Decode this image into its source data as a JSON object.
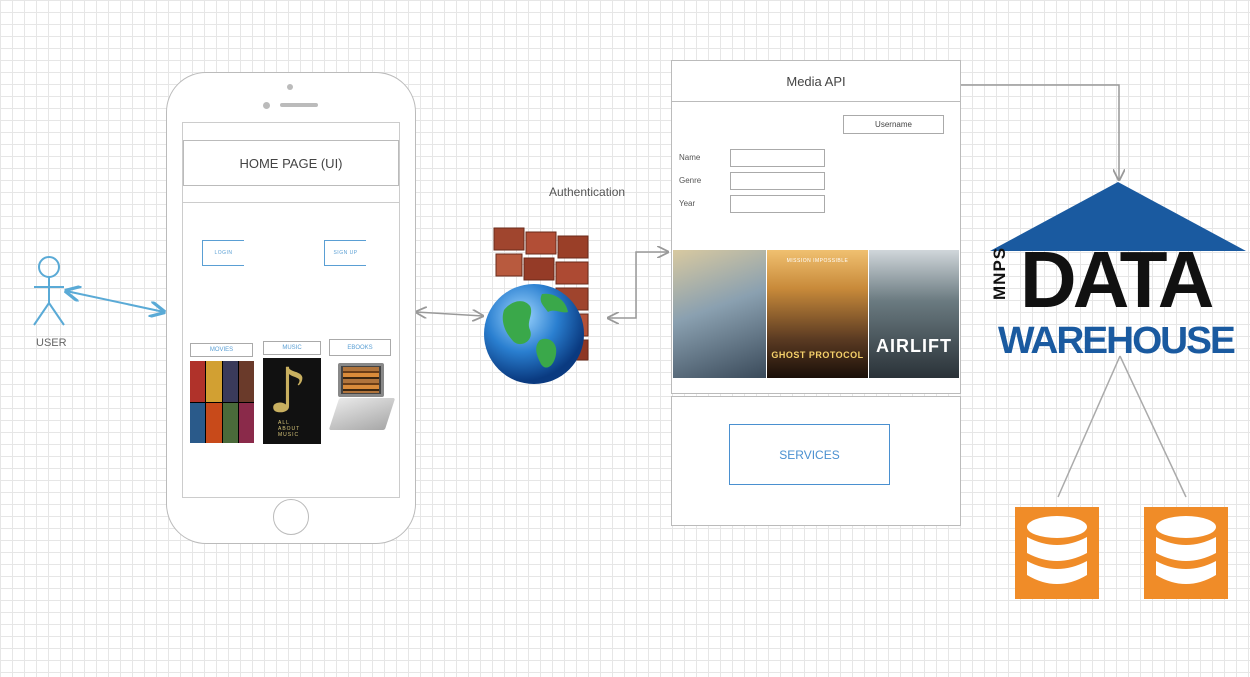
{
  "actor": {
    "label": "USER"
  },
  "phone": {
    "home_page_label": "HOME PAGE (UI)",
    "buttons": [
      {
        "label": "LOGIN"
      },
      {
        "label": "SIGN UP"
      }
    ],
    "categories": [
      {
        "label": "MOVIES"
      },
      {
        "label": "MUSIC"
      },
      {
        "label": "EBOOKS"
      }
    ],
    "music_tile_words": "ALL ABOUT MUSIC"
  },
  "authentication": {
    "label": "Authentication"
  },
  "media_api": {
    "title": "Media API",
    "username_label": "Username",
    "fields": [
      {
        "label": "Name"
      },
      {
        "label": "Genre"
      },
      {
        "label": "Year"
      }
    ],
    "posters": [
      {
        "title": "",
        "tagline": ""
      },
      {
        "title": "GHOST PROTOCOL",
        "tagline": "MISSION IMPOSSIBLE"
      },
      {
        "title": "AIRLIFT",
        "tagline": ""
      }
    ],
    "services_label": "SERVICES"
  },
  "data_warehouse": {
    "side_text": "MNPS",
    "main_text": "DATA",
    "sub_text": "WAREHOUSE"
  },
  "colors": {
    "accent_blue": "#4a90d0",
    "warehouse_blue": "#1a5aa0",
    "database_orange": "#f08c28",
    "arrow_blue": "#5aaad6"
  }
}
